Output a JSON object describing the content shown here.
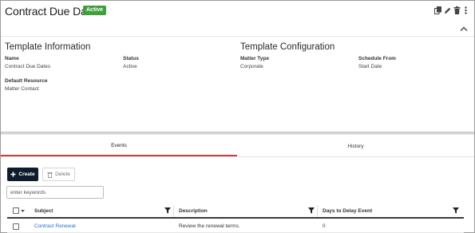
{
  "header": {
    "title": "Contract Due Dates",
    "status_badge": "Active",
    "tools": [
      "copy-icon",
      "edit-icon",
      "trash-icon",
      "more-vertical-icon"
    ],
    "collapse_icon": "chevron-up-icon"
  },
  "template_information": {
    "heading": "Template Information",
    "name_label": "Name",
    "name_value": "Contract Due Dates",
    "status_label": "Status",
    "status_value": "Active",
    "default_resource_label": "Default Resource",
    "default_resource_value": "Matter Contact"
  },
  "template_configuration": {
    "heading": "Template Configuration",
    "matter_type_label": "Matter Type",
    "matter_type_value": "Corporate",
    "schedule_from_label": "Schedule From",
    "schedule_from_value": "Start Date"
  },
  "tabs": [
    {
      "label": "Events",
      "active": true
    },
    {
      "label": "History",
      "active": false
    }
  ],
  "toolbar": {
    "create_label": "Create",
    "delete_label": "Delete",
    "search_placeholder": "enter keywords"
  },
  "table": {
    "columns": [
      "Subject",
      "Description",
      "Days to Delay Event"
    ],
    "rows": [
      {
        "subject": "Contract Renewal",
        "description": "Review the renewal terms.",
        "days": "0"
      }
    ]
  },
  "colors": {
    "badge": "#3f9f3a",
    "create_button": "#0f1c2e",
    "active_tab_underline": "#d93a3a",
    "link": "#2a6fc9"
  }
}
